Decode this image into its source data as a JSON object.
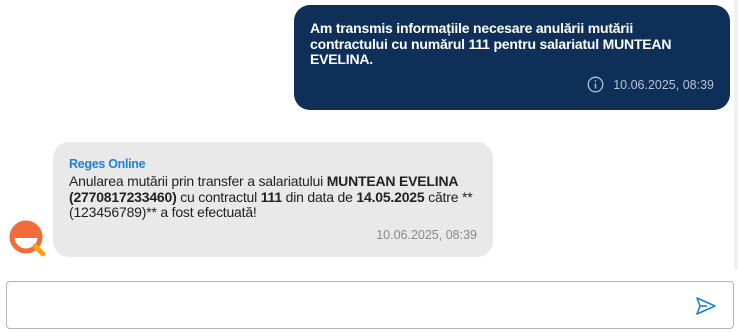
{
  "messages": {
    "user": {
      "text": "Am transmis informațiile necesare anulării mutării contractului cu numărul 111 pentru salariatul MUNTEAN EVELINA.",
      "timestamp": "10.06.2025, 08:39",
      "info_icon": "info-icon"
    },
    "bot": {
      "sender": "Reges Online",
      "parts": {
        "p1": "Anularea mutării prin transfer a salariatului ",
        "b1": "MUNTEAN EVELINA (2770817233460)",
        "p2": " cu contractul ",
        "b2": "111",
        "p3": " din data de ",
        "b3": "14.05.2025",
        "p4": " către ** (123456789)** a fost efectuată!"
      },
      "timestamp": "10.06.2025, 08:39",
      "avatar_icon": "reges-logo-icon"
    }
  },
  "composer": {
    "value": "",
    "placeholder": "",
    "send_icon": "send-icon"
  },
  "colors": {
    "user_bubble": "#0d2f58",
    "bot_bubble": "#e9e9e9",
    "accent": "#1a82d9",
    "logo_orange": "#f26b3a"
  }
}
